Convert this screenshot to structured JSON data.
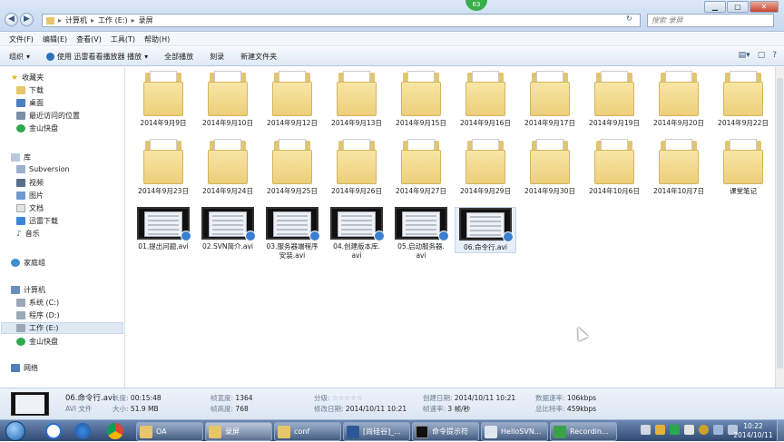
{
  "window": {
    "badge": "63",
    "controls": {
      "min": "▁",
      "max": "▢",
      "close": "✕"
    }
  },
  "address": {
    "path": [
      "计算机",
      "工作 (E:)",
      "录屏"
    ],
    "search_placeholder": "搜索 录屏"
  },
  "menu": [
    "文件(F)",
    "编辑(E)",
    "查看(V)",
    "工具(T)",
    "帮助(H)"
  ],
  "toolbar": {
    "organize": "组织",
    "play_with": "使用 迅雷看看播放器 播放",
    "play_all": "全部播放",
    "burn": "刻录",
    "new_folder": "新建文件夹"
  },
  "nav": {
    "favorites": "收藏夹",
    "downloads": "下载",
    "desktop": "桌面",
    "recent": "最近访问的位置",
    "kuaipan": "金山快盘",
    "library": "库",
    "subversion": "Subversion",
    "videos": "视频",
    "pictures": "图片",
    "documents": "文档",
    "xunlei": "迅雷下载",
    "music": "音乐",
    "homegroup": "家庭组",
    "computer": "计算机",
    "system": "系统 (C:)",
    "program": "程序 (D:)",
    "work": "工作 (E:)",
    "kuaipan2": "金山快盘",
    "network": "网络"
  },
  "folders": [
    "2014年9月9日",
    "2014年9月10日",
    "2014年9月12日",
    "2014年9月13日",
    "2014年9月15日",
    "2014年9月16日",
    "2014年9月17日",
    "2014年9月19日",
    "2014年9月20日",
    "2014年9月22日",
    "2014年9月23日",
    "2014年9月24日",
    "2014年9月25日",
    "2014年9月26日",
    "2014年9月27日",
    "2014年9月29日",
    "2014年9月30日",
    "2014年10月6日",
    "2014年10月7日",
    "课堂笔记"
  ],
  "videos": [
    {
      "l1": "01.提出问题.avi",
      "l2": ""
    },
    {
      "l1": "02.SVN简介.avi",
      "l2": ""
    },
    {
      "l1": "03.服务器端程序",
      "l2": "安装.avi"
    },
    {
      "l1": "04.创建版本库.",
      "l2": "avi"
    },
    {
      "l1": "05.启动服务器.",
      "l2": "avi"
    },
    {
      "l1": "06.命令行.avi",
      "l2": ""
    }
  ],
  "selected_video_index": 5,
  "details": {
    "name": "06.命令行.avi",
    "type": "AVI 文件",
    "length_k": "长度:",
    "length_v": "00:15:48",
    "size_k": "大小:",
    "size_v": "51.9 MB",
    "width_k": "帧宽度:",
    "width_v": "1364",
    "height_k": "帧高度:",
    "height_v": "768",
    "rating_k": "分级:",
    "rating_v": "☆☆☆☆☆",
    "modified_k": "修改日期:",
    "modified_v": "2014/10/11 10:21",
    "created_k": "创建日期:",
    "created_v": "2014/10/11 10:21",
    "framerate_k": "帧速率:",
    "framerate_v": "3 帧/秒",
    "datarate_k": "数据速率:",
    "datarate_v": "106kbps",
    "bitrate_k": "总比特率:",
    "bitrate_v": "459kbps"
  },
  "taskbar": {
    "items": [
      "OA",
      "录屏",
      "conf",
      "[尚硅谷]_...",
      "命令提示符",
      "HelloSVN...",
      "Recordin..."
    ],
    "time": "10:22",
    "date": "2014/10/11"
  },
  "colors": {
    "folder": "#eccf7a",
    "taskbar": "#2f4a72",
    "accent": "#3b7fd0"
  }
}
